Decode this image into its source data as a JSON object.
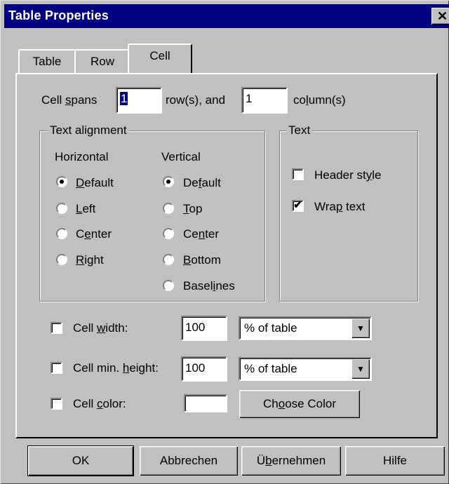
{
  "window": {
    "title": "Table Properties",
    "close_glyph": "✕"
  },
  "tabs": [
    {
      "label": "Table",
      "active": false
    },
    {
      "label": "Row",
      "active": false
    },
    {
      "label": "Cell",
      "active": true
    }
  ],
  "spans": {
    "label_pre": "Cell ",
    "label_u": "s",
    "label_post": "pans",
    "rows_value": "1",
    "rows_label": "row(s), and",
    "cols_value": "1",
    "cols_label_pre": "co",
    "cols_label_u": "l",
    "cols_label_post": "umn(s)"
  },
  "alignment": {
    "group_label": "Text alignment",
    "horizontal_heading": "Horizontal",
    "vertical_heading": "Vertical",
    "horizontal": [
      {
        "pre": "",
        "u": "D",
        "post": "efault",
        "checked": true
      },
      {
        "pre": "",
        "u": "L",
        "post": "eft",
        "checked": false
      },
      {
        "pre": "C",
        "u": "e",
        "post": "nter",
        "checked": false
      },
      {
        "pre": "",
        "u": "R",
        "post": "ight",
        "checked": false
      }
    ],
    "vertical": [
      {
        "pre": "De",
        "u": "f",
        "post": "ault",
        "checked": true
      },
      {
        "pre": "",
        "u": "T",
        "post": "op",
        "checked": false
      },
      {
        "pre": "Ce",
        "u": "n",
        "post": "ter",
        "checked": false
      },
      {
        "pre": "",
        "u": "B",
        "post": "ottom",
        "checked": false
      },
      {
        "pre": "Basel",
        "u": "i",
        "post": "nes",
        "checked": false
      }
    ]
  },
  "text_group": {
    "group_label": "Text",
    "header_style": {
      "pre": "Header st",
      "u": "y",
      "post": "le",
      "checked": false
    },
    "wrap_text": {
      "pre": "Wra",
      "u": "p",
      "post": " text",
      "checked": true
    }
  },
  "cell_width": {
    "pre": "Cell ",
    "u": "w",
    "post": "idth:",
    "checked": false,
    "value": "100",
    "unit": "% of table"
  },
  "cell_min_height": {
    "pre": "Cell min. ",
    "u": "h",
    "post": "eight:",
    "checked": false,
    "value": "100",
    "unit": "% of table"
  },
  "cell_color": {
    "pre": "Cell ",
    "u": "c",
    "post": "olor:",
    "checked": false,
    "swatch": "#ffffff",
    "button_pre": "Ch",
    "button_u": "o",
    "button_post": "ose Color"
  },
  "footer": {
    "ok": "OK",
    "cancel": "Abbrechen",
    "apply_pre": "Ü",
    "apply_u": "b",
    "apply_post": "ernehmen",
    "help": "Hilfe"
  },
  "check_glyph": "✔",
  "dropdown_glyph": "▼"
}
